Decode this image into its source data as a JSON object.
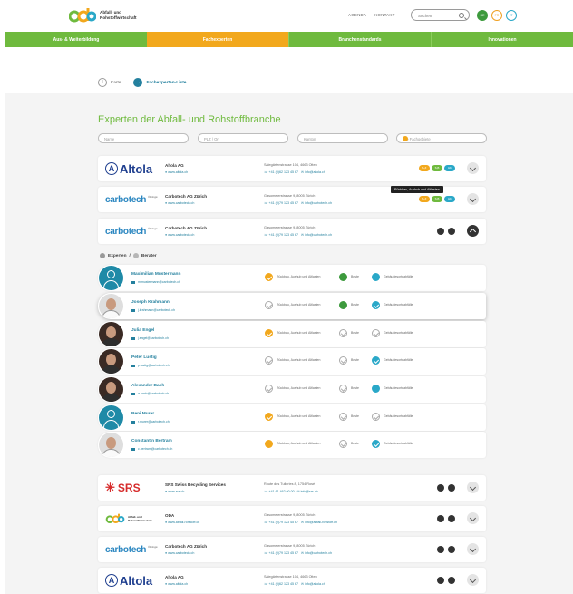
{
  "header": {
    "logo_word": "oda",
    "logo_line1": "Abfall- und",
    "logo_line2": "Rohstoffwirtschaft",
    "nav_links": [
      "AGENDA",
      "KONTAKT"
    ],
    "search_placeholder": "Suchen",
    "languages": [
      "DE",
      "FR",
      "IT"
    ]
  },
  "mainnav": [
    "Aus- & Weiterbildung",
    "Fachexperten",
    "Branchenstandards",
    "Innovationen"
  ],
  "breadcrumb": {
    "step1_num": "1",
    "step1": "Karte",
    "step2_num": "→",
    "step2": "Fachexperten-Liste"
  },
  "title": "Experten der Abfall- und Rohstoffbranche",
  "filters": {
    "name": "Name",
    "plz": "PLZ / Ort",
    "kanton": "Kanton",
    "fachgebiete": "alle Fachgebiete"
  },
  "companies_top": [
    {
      "logo": "Altola",
      "logo_tag": "Recycling ohne Grenzen",
      "name": "Altola AG",
      "url": "www.altola.ch",
      "addr": "Sälegärtenstrasse 104, 4663 Olten",
      "phone": "+41 (0)62 123 45 67",
      "mail": "info@altola.ch",
      "badges": [
        "A,Z",
        "S,B",
        "Hb"
      ]
    },
    {
      "logo": "carbotech",
      "logo_tag": "Ökologie",
      "name": "Carbotech AG Zürich",
      "url": "www.carbotech.ch",
      "addr": "Gasometerstrasse 9, 8005 Zürich",
      "phone": "+41 (0)79 123 45 67",
      "mail": "info@carbotech.ch",
      "badges": [
        "A,Z",
        "S,B",
        "Hb"
      ]
    },
    {
      "logo": "carbotech",
      "logo_tag": "Ökologie",
      "name": "Carbotech AG Zürich",
      "url": "www.carbotech.ch",
      "addr": "Gasometerstrasse 9, 8005 Zürich",
      "phone": "+41 (0)79 123 45 67",
      "mail": "info@carbotech.ch"
    }
  ],
  "tooltip": "Rückbau, Aushub und Altlasten",
  "experts_header": {
    "a": "Experten",
    "sep": "/",
    "b": "Berater"
  },
  "expert_cat": [
    "Rückbau, Aushub und Altlasten",
    "Beste",
    "Gebäudesorteabfälle"
  ],
  "experts": [
    {
      "name": "Maximilian Mustermann",
      "email": "m.mustermann@carbotech.ch"
    },
    {
      "name": "Joseph Krahmann",
      "email": "j.krahmann@carbotech.ch"
    },
    {
      "name": "Julia Engel",
      "email": "j.engel@carbotech.ch"
    },
    {
      "name": "Peter Lustig",
      "email": "p.lustig@carbotech.ch"
    },
    {
      "name": "Alexander Bach",
      "email": "a.bach@carbotech.ch"
    },
    {
      "name": "Reni Murer",
      "email": "r.murer@carbotech.ch"
    },
    {
      "name": "Constantin Bertram",
      "email": "c.bertram@carbotech.ch"
    }
  ],
  "companies_bottom": [
    {
      "logo": "SRS",
      "name": "SRS Swiss Recycling Services",
      "url": "www.srs.ch",
      "addr": "Route des Tuileries 8, 1754 Rosé",
      "phone": "+41 61 462 00 00",
      "mail": "info@srs.ch"
    },
    {
      "logo": "oda",
      "logo_line1": "Abfall- und",
      "logo_line2": "Rohstoffwirtschaft",
      "name": "ODA",
      "url": "www.abfall-rohstoff.ch",
      "addr": "Gasometerstrasse 9, 8005 Zürich",
      "phone": "+41 (0)79 123 45 67",
      "mail": "info@abfall-rohstoff.ch"
    },
    {
      "logo": "carbotech",
      "logo_tag": "Ökologie",
      "name": "Carbotech AG Zürich",
      "url": "www.carbotech.ch",
      "addr": "Gasometerstrasse 9, 8005 Zürich",
      "phone": "+41 (0)79 123 45 67",
      "mail": "info@carbotech.ch"
    },
    {
      "logo": "Altola",
      "logo_tag": "Recycling ohne Grenzen",
      "name": "Altola AG",
      "url": "www.altola.ch",
      "addr": "Sälegärtenstrasse 104, 4663 Olten",
      "phone": "+41 (0)62 123 45 67",
      "mail": "info@altola.ch"
    }
  ],
  "colors": {
    "green": "#6fba3e",
    "orange": "#f2a81d",
    "teal": "#24809e",
    "cyan": "#2aa8c8"
  }
}
